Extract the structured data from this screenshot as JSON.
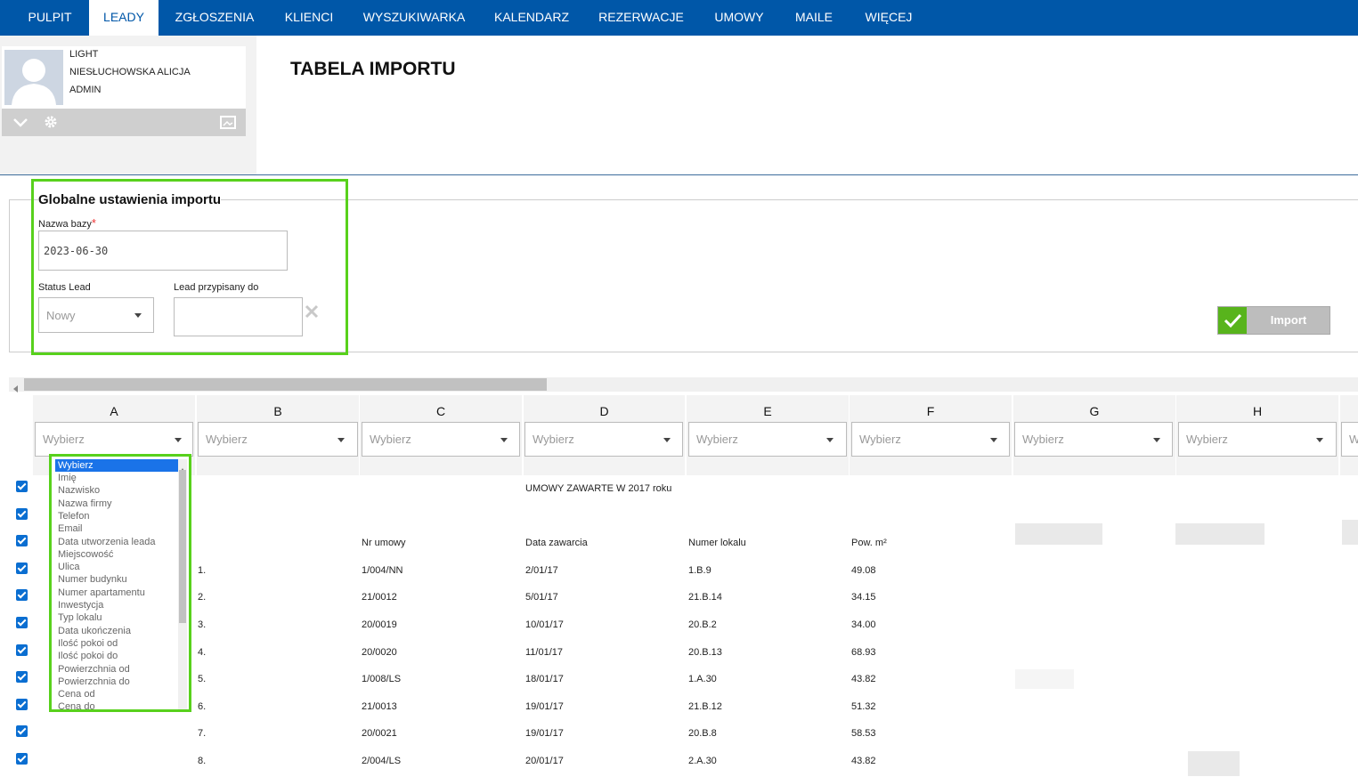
{
  "nav": {
    "items": [
      {
        "label": "PULPIT"
      },
      {
        "label": "LEADY"
      },
      {
        "label": "ZGŁOSZENIA"
      },
      {
        "label": "KLIENCI"
      },
      {
        "label": "WYSZUKIWARKA"
      },
      {
        "label": "KALENDARZ"
      },
      {
        "label": "REZERWACJE"
      },
      {
        "label": "UMOWY"
      },
      {
        "label": "MAILE"
      },
      {
        "label": "WIĘCEJ"
      }
    ],
    "active": "LEADY"
  },
  "user": {
    "plan": "LIGHT",
    "name": "NIESŁUCHOWSKA ALICJA",
    "role": "ADMIN",
    "icons": [
      "chevron-down-icon",
      "gear-icon",
      "picture-icon"
    ]
  },
  "page": {
    "title": "TABELA IMPORTU"
  },
  "settings": {
    "legend": "Globalne ustawienia importu",
    "db_name_label": "Nazwa bazy",
    "db_name_required": "*",
    "db_name_value": "2023-06-30",
    "status_label": "Status Lead",
    "status_value": "Nowy",
    "assigned_label": "Lead przypisany do",
    "assigned_value": "",
    "clear_icon": "close-icon"
  },
  "import_button": {
    "label": "Import",
    "icon": "check-icon",
    "color": "#58b41c"
  },
  "grid": {
    "columns": [
      {
        "letter": "A",
        "select": "Wybierz"
      },
      {
        "letter": "B",
        "select": "Wybierz"
      },
      {
        "letter": "C",
        "select": "Wybierz"
      },
      {
        "letter": "D",
        "select": "Wybierz"
      },
      {
        "letter": "E",
        "select": "Wybierz"
      },
      {
        "letter": "F",
        "select": "Wybierz"
      },
      {
        "letter": "G",
        "select": "Wybierz"
      },
      {
        "letter": "H",
        "select": "Wybierz"
      },
      {
        "letter": "",
        "select": "W"
      }
    ],
    "title_row": "UMOWY ZAWARTE W 2017 roku",
    "headers": {
      "c": "Nr umowy",
      "d": "Data zawarcia",
      "e": "Numer lokalu",
      "f": "Pow. m²"
    },
    "rows": [
      {
        "b": "1.",
        "c": "1/004/NN",
        "d": "2/01/17",
        "e": "1.B.9",
        "f": "49.08"
      },
      {
        "b": "2.",
        "c": "21/0012",
        "d": "5/01/17",
        "e": "21.B.14",
        "f": "34.15"
      },
      {
        "b": "3.",
        "c": "20/0019",
        "d": "10/01/17",
        "e": "20.B.2",
        "f": "34.00"
      },
      {
        "b": "4.",
        "c": "20/0020",
        "d": "11/01/17",
        "e": "20.B.13",
        "f": "68.93"
      },
      {
        "b": "5.",
        "c": "1/008/LS",
        "d": "18/01/17",
        "e": "1.A.30",
        "f": "43.82"
      },
      {
        "b": "6.",
        "c": "21/0013",
        "d": "19/01/17",
        "e": "21.B.12",
        "f": "51.32"
      },
      {
        "b": "7.",
        "c": "20/0021",
        "d": "19/01/17",
        "e": "20.B.8",
        "f": "58.53"
      },
      {
        "b": "8.",
        "c": "2/004/LS",
        "d": "20/01/17",
        "e": "2.A.30",
        "f": "43.82"
      }
    ]
  },
  "dropdown": {
    "options": [
      "Wybierz",
      "Imię",
      "Nazwisko",
      "Nazwa firmy",
      "Telefon",
      "Email",
      "Data utworzenia leada",
      "Miejscowość",
      "Ulica",
      "Numer budynku",
      "Numer apartamentu",
      "Inwestycja",
      "Typ lokalu",
      "Data ukończenia",
      "Ilość pokoi od",
      "Ilość pokoi do",
      "Powierzchnia od",
      "Powierzchnia do",
      "Cena od",
      "Cena do"
    ],
    "selected": "Wybierz"
  },
  "highlight_color": "#58d11c"
}
